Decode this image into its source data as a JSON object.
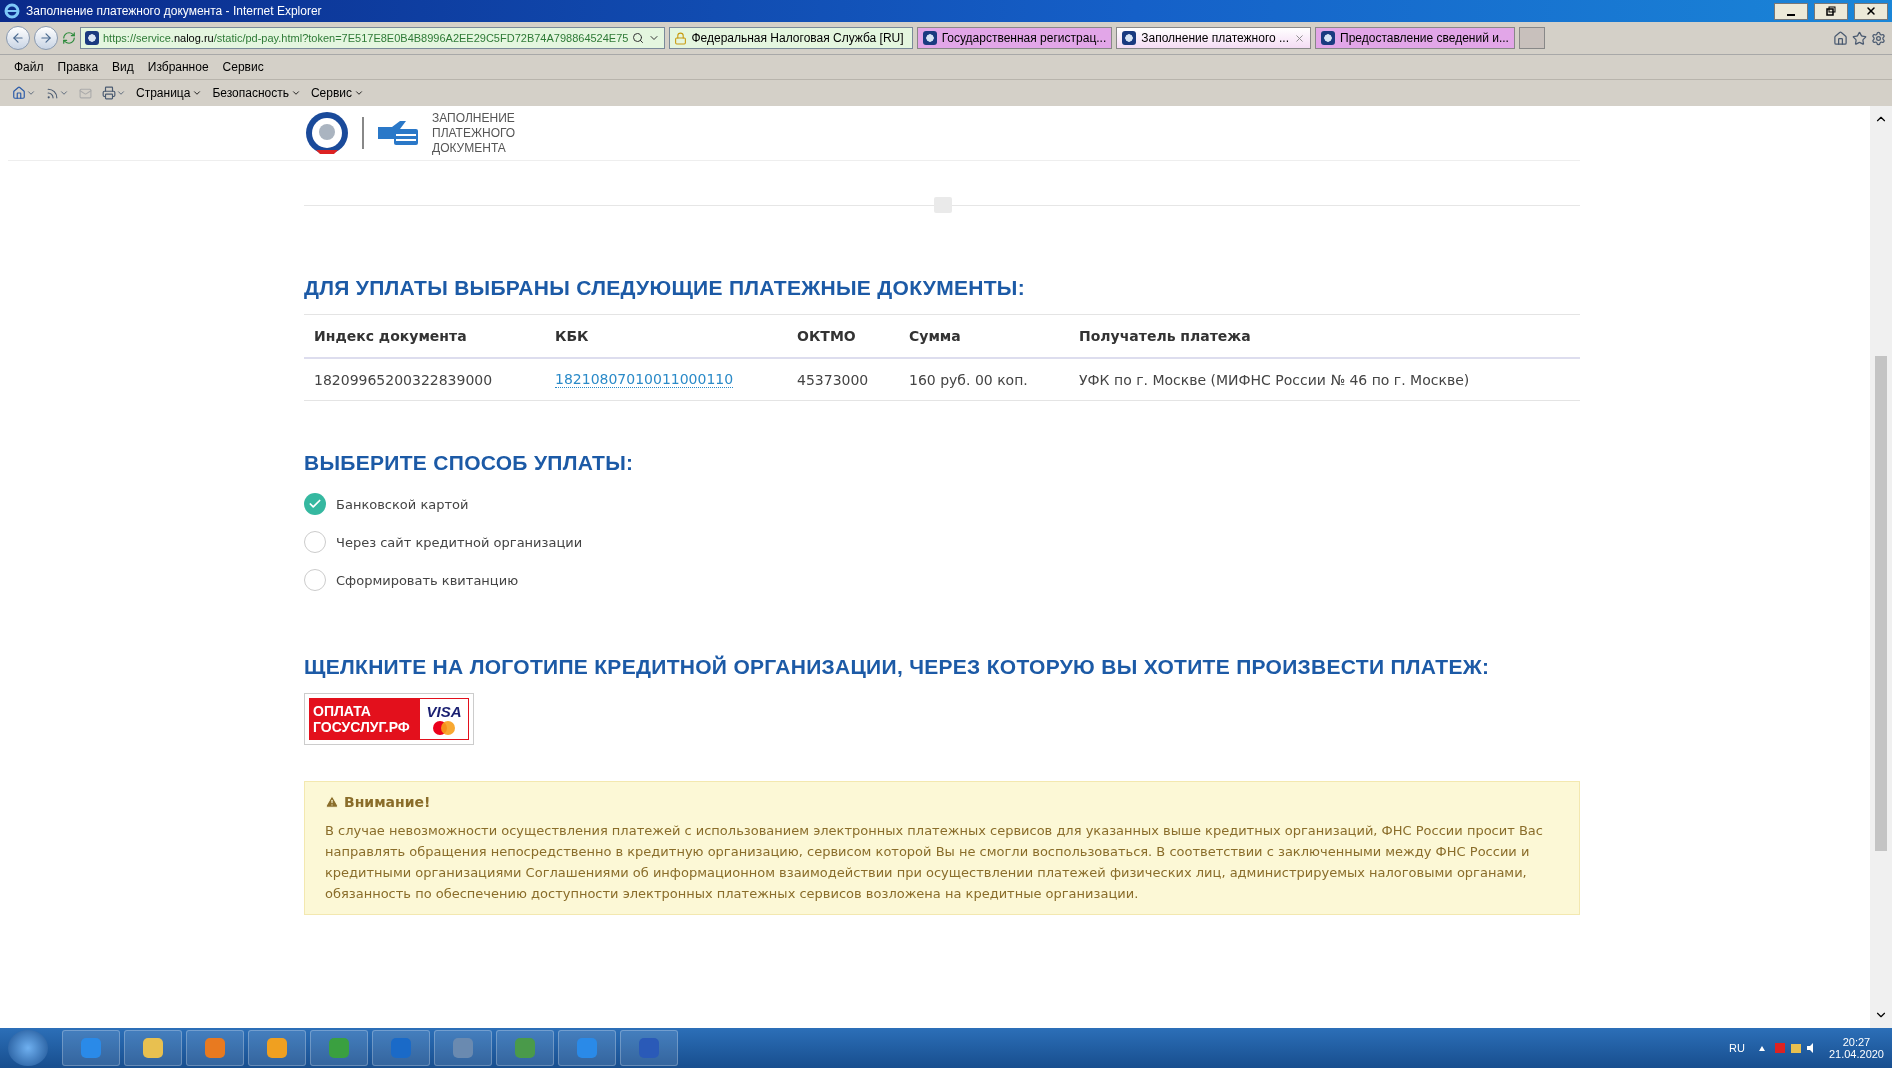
{
  "window": {
    "title": "Заполнение платежного документа - Internet Explorer"
  },
  "address_bar": {
    "url": "https://service.**nalog.ru**/static/pd-pay.html?token=7E517E8E0B4B8996A2EE29C5FD72B74A798864524E75",
    "security_label": "Федеральная Налоговая Служба [RU]"
  },
  "tabs": [
    {
      "label": "Государственная регистрац...",
      "selected": false
    },
    {
      "label": "Заполнение платежного ...",
      "selected": true
    },
    {
      "label": "Предоставление сведений и...",
      "selected": false
    }
  ],
  "menu": [
    "Файл",
    "Правка",
    "Вид",
    "Избранное",
    "Сервис"
  ],
  "command_bar": [
    "Страница",
    "Безопасность",
    "Сервис"
  ],
  "header": {
    "title": "ЗАПОЛНЕНИЕ ПЛАТЕЖНОГО ДОКУМЕНТА"
  },
  "documents": {
    "heading": "ДЛЯ УПЛАТЫ ВЫБРАНЫ СЛЕДУЮЩИЕ ПЛАТЕЖНЫЕ ДОКУМЕНТЫ:",
    "columns": [
      "Индекс документа",
      "КБК",
      "ОКТМО",
      "Сумма",
      "Получатель платежа"
    ],
    "rows": [
      {
        "index": "18209965200322839000",
        "kbk": "18210807010011000110",
        "oktmo": "45373000",
        "sum": "160 руб. 00 коп.",
        "recipient": "УФК по г. Москве (МИФНС России № 46 по г. Москве)"
      }
    ]
  },
  "payment_method": {
    "heading": "ВЫБЕРИТЕ СПОСОБ УПЛАТЫ:",
    "options": [
      {
        "label": "Банковской картой",
        "selected": true
      },
      {
        "label": "Через сайт кредитной организации",
        "selected": false
      },
      {
        "label": "Сформировать квитанцию",
        "selected": false
      }
    ]
  },
  "banks": {
    "heading": "ЩЕЛКНИТЕ НА ЛОГОТИПЕ КРЕДИТНОЙ ОРГАНИЗАЦИИ, ЧЕРЕЗ КОТОРУЮ ВЫ ХОТИТЕ ПРОИЗВЕСТИ ПЛАТЕЖ:",
    "logos": [
      {
        "line_1": "ОПЛАТА",
        "line_2": "ГОСУСЛУГ.РФ",
        "card": "VISA"
      }
    ]
  },
  "notice": {
    "title": "Внимание!",
    "text": "В случае невозможности осуществления платежей с использованием электронных платежных сервисов для указанных выше кредитных организаций, ФНС России просит Вас направлять обращения непосредственно в кредитную организацию, сервисом которой Вы не смогли воспользоваться. В соответствии с заключенными между ФНС России и кредитными организациями Соглашениями об информационном взаимодействии при осуществлении платежей физических лиц, администрируемых налоговыми органами, обязанность по обеспечению доступности электронных платежных сервисов возложена на кредитные организации."
  },
  "tray": {
    "language": "RU",
    "time": "20:27",
    "date": "21.04.2020"
  }
}
